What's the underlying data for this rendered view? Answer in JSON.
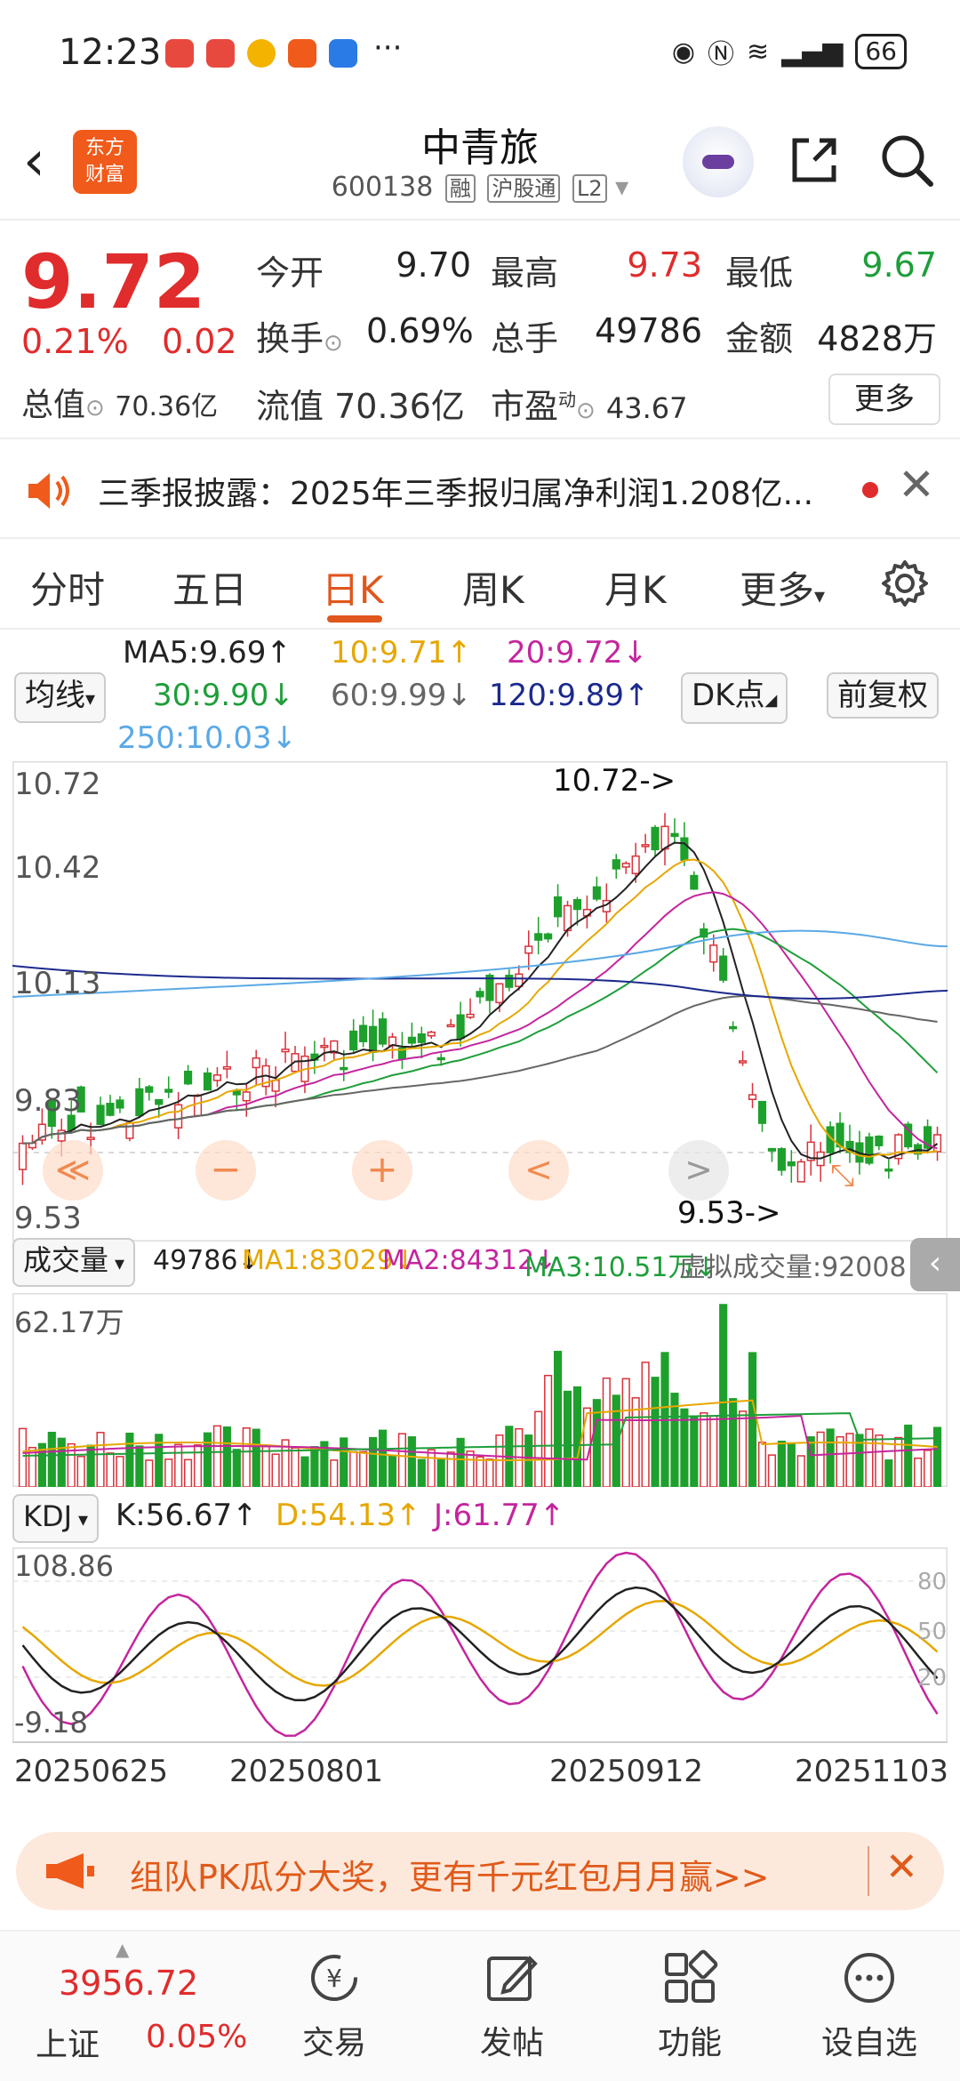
{
  "status_bar": {
    "time": "12:23",
    "battery": "66",
    "more": "···"
  },
  "header": {
    "title": "中青旅",
    "code": "600138",
    "tags": [
      "融",
      "沪股通",
      "L2"
    ],
    "logo_text": [
      "东方",
      "财富"
    ]
  },
  "quote": {
    "price": "9.72",
    "change_pct": "0.21%",
    "change_val": "0.02",
    "fields": [
      {
        "label": "今开",
        "value": "9.70",
        "color": "#222222"
      },
      {
        "label": "最高",
        "value": "9.73",
        "color": "#e02c2c"
      },
      {
        "label": "最低",
        "value": "9.67",
        "color": "#1e9e3a"
      },
      {
        "label": "换手",
        "value": "0.69%",
        "color": "#222222"
      },
      {
        "label": "总手",
        "value": "49786",
        "color": "#222222"
      },
      {
        "label": "金额",
        "value": "4828万",
        "color": "#222222"
      }
    ],
    "total_value_label": "总值",
    "total_value": "70.36亿",
    "float_label": "流值",
    "float_value": "70.36亿",
    "pe_label": "市盈",
    "pe_sup": "动",
    "pe_value": "43.67",
    "more_label": "更多"
  },
  "notice": {
    "text": "三季报披露：2025年三季报归属净利润1.208亿..."
  },
  "tabs": [
    "分时",
    "五日",
    "日K",
    "周K",
    "月K",
    "更多"
  ],
  "active_tab": "日K",
  "ma": {
    "selector": "均线",
    "items": [
      {
        "text": "MA5:9.69↑",
        "color": "#222222"
      },
      {
        "text": "10:9.71↑",
        "color": "#e6a700"
      },
      {
        "text": "20:9.72↓",
        "color": "#c4259e"
      },
      {
        "text": "30:9.90↓",
        "color": "#1e9e3a"
      },
      {
        "text": "60:9.99↓",
        "color": "#666666"
      },
      {
        "text": "120:9.89↑",
        "color": "#1c2a8c"
      },
      {
        "text": "250:10.03↓",
        "color": "#5aa9e6"
      }
    ],
    "dk_label": "DK点",
    "adjust_label": "前复权"
  },
  "kline": {
    "y_labels": [
      "10.72",
      "10.42",
      "10.13",
      "9.83",
      "9.53"
    ],
    "high_marker": "10.72->",
    "low_marker": "9.53->",
    "controls": [
      "≪",
      "−",
      "+",
      "<",
      ">"
    ]
  },
  "volume": {
    "selector": "成交量",
    "items": [
      {
        "text": "49786↓",
        "color": "#222222"
      },
      {
        "text": "MA1:83029↓",
        "color": "#e6a700"
      },
      {
        "text": "MA2:84312↓",
        "color": "#c4259e"
      },
      {
        "text": "MA3:10.51万↓",
        "color": "#1e9e3a"
      },
      {
        "text": "虚拟成交量:92008",
        "color": "#666666"
      }
    ],
    "max_label": "62.17万"
  },
  "kdj": {
    "selector": "KDJ",
    "items": [
      {
        "text": "K:56.67↑",
        "color": "#222222"
      },
      {
        "text": "D:54.13↑",
        "color": "#e6a700"
      },
      {
        "text": "J:61.77↑",
        "color": "#c4259e"
      }
    ],
    "y_top": "108.86",
    "y_bottom": "-9.18",
    "levels": [
      "80",
      "50",
      "20"
    ]
  },
  "dates": [
    "20250625",
    "20250801",
    "20250912",
    "20251103"
  ],
  "banner": {
    "text": "组队PK瓜分大奖，更有千元红包月月赢>>"
  },
  "bottom_nav": {
    "index_value": "3956.72",
    "index_name": "上证",
    "index_change": "0.05%",
    "items": [
      "交易",
      "发帖",
      "功能",
      "设自选"
    ]
  }
}
